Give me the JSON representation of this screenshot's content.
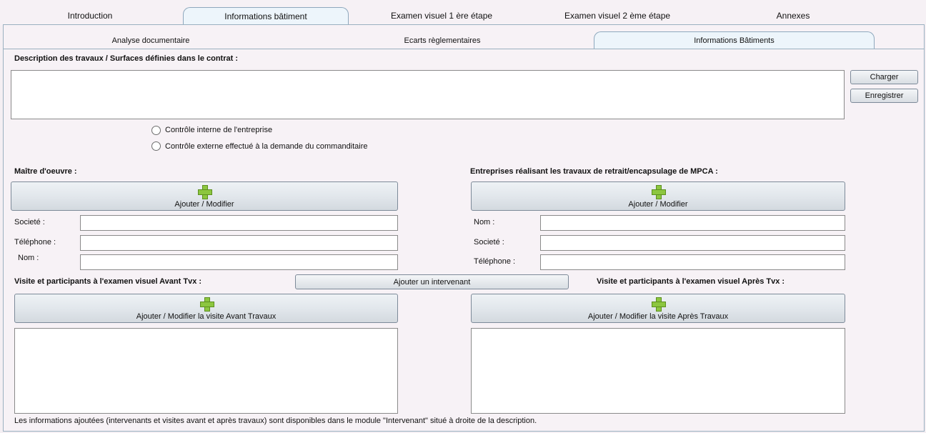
{
  "top_tabs": [
    {
      "label": "Introduction",
      "active": false
    },
    {
      "label": "Informations bâtiment",
      "active": true
    },
    {
      "label": "Examen visuel 1 ère étape",
      "active": false
    },
    {
      "label": "Examen visuel 2 ème étape",
      "active": false
    },
    {
      "label": "Annexes",
      "active": false
    }
  ],
  "sub_tabs": [
    {
      "label": "Analyse documentaire",
      "active": false
    },
    {
      "label": "Ecarts règlementaires",
      "active": false
    },
    {
      "label": "Informations Bâtiments",
      "active": true
    }
  ],
  "description": {
    "label": "Description des travaux / Surfaces définies dans le contrat :",
    "value": ""
  },
  "side_buttons": {
    "load": "Charger",
    "save": "Enregistrer"
  },
  "control_options": [
    {
      "label": "Contrôle interne de l'entreprise",
      "checked": false
    },
    {
      "label": "Contrôle externe effectué à la demande du commanditaire",
      "checked": false
    }
  ],
  "maitre_oeuvre": {
    "title": "Maître d'oeuvre :",
    "add_button": "Ajouter / Modifier",
    "fields": [
      {
        "label": "Societé :",
        "value": ""
      },
      {
        "label": "Téléphone :",
        "value": ""
      },
      {
        "label": "Nom :",
        "value": ""
      }
    ]
  },
  "entreprises": {
    "title": "Entreprises réalisant les travaux de retrait/encapsulage de MPCA :",
    "add_button": "Ajouter / Modifier",
    "fields": [
      {
        "label": "Nom :",
        "value": ""
      },
      {
        "label": "Societé :",
        "value": ""
      },
      {
        "label": "Téléphone :",
        "value": ""
      }
    ]
  },
  "visites": {
    "avant_title": "Visite et participants à l'examen visuel Avant Tvx :",
    "apres_title": "Visite et participants à l'examen visuel Après Tvx :",
    "add_intervenant": "Ajouter un intervenant",
    "avant_button": "Ajouter / Modifier la visite Avant Travaux",
    "apres_button": "Ajouter / Modifier la visite Après Travaux"
  },
  "footer_note": "Les informations ajoutées (intervenants et visites avant et après travaux) sont disponibles dans le module \"Intervenant\" situé à droite de la description.",
  "colors": {
    "background": "#f4eff3",
    "active_tab": "#edf5fb",
    "plus_icon": "#8cc63f"
  }
}
